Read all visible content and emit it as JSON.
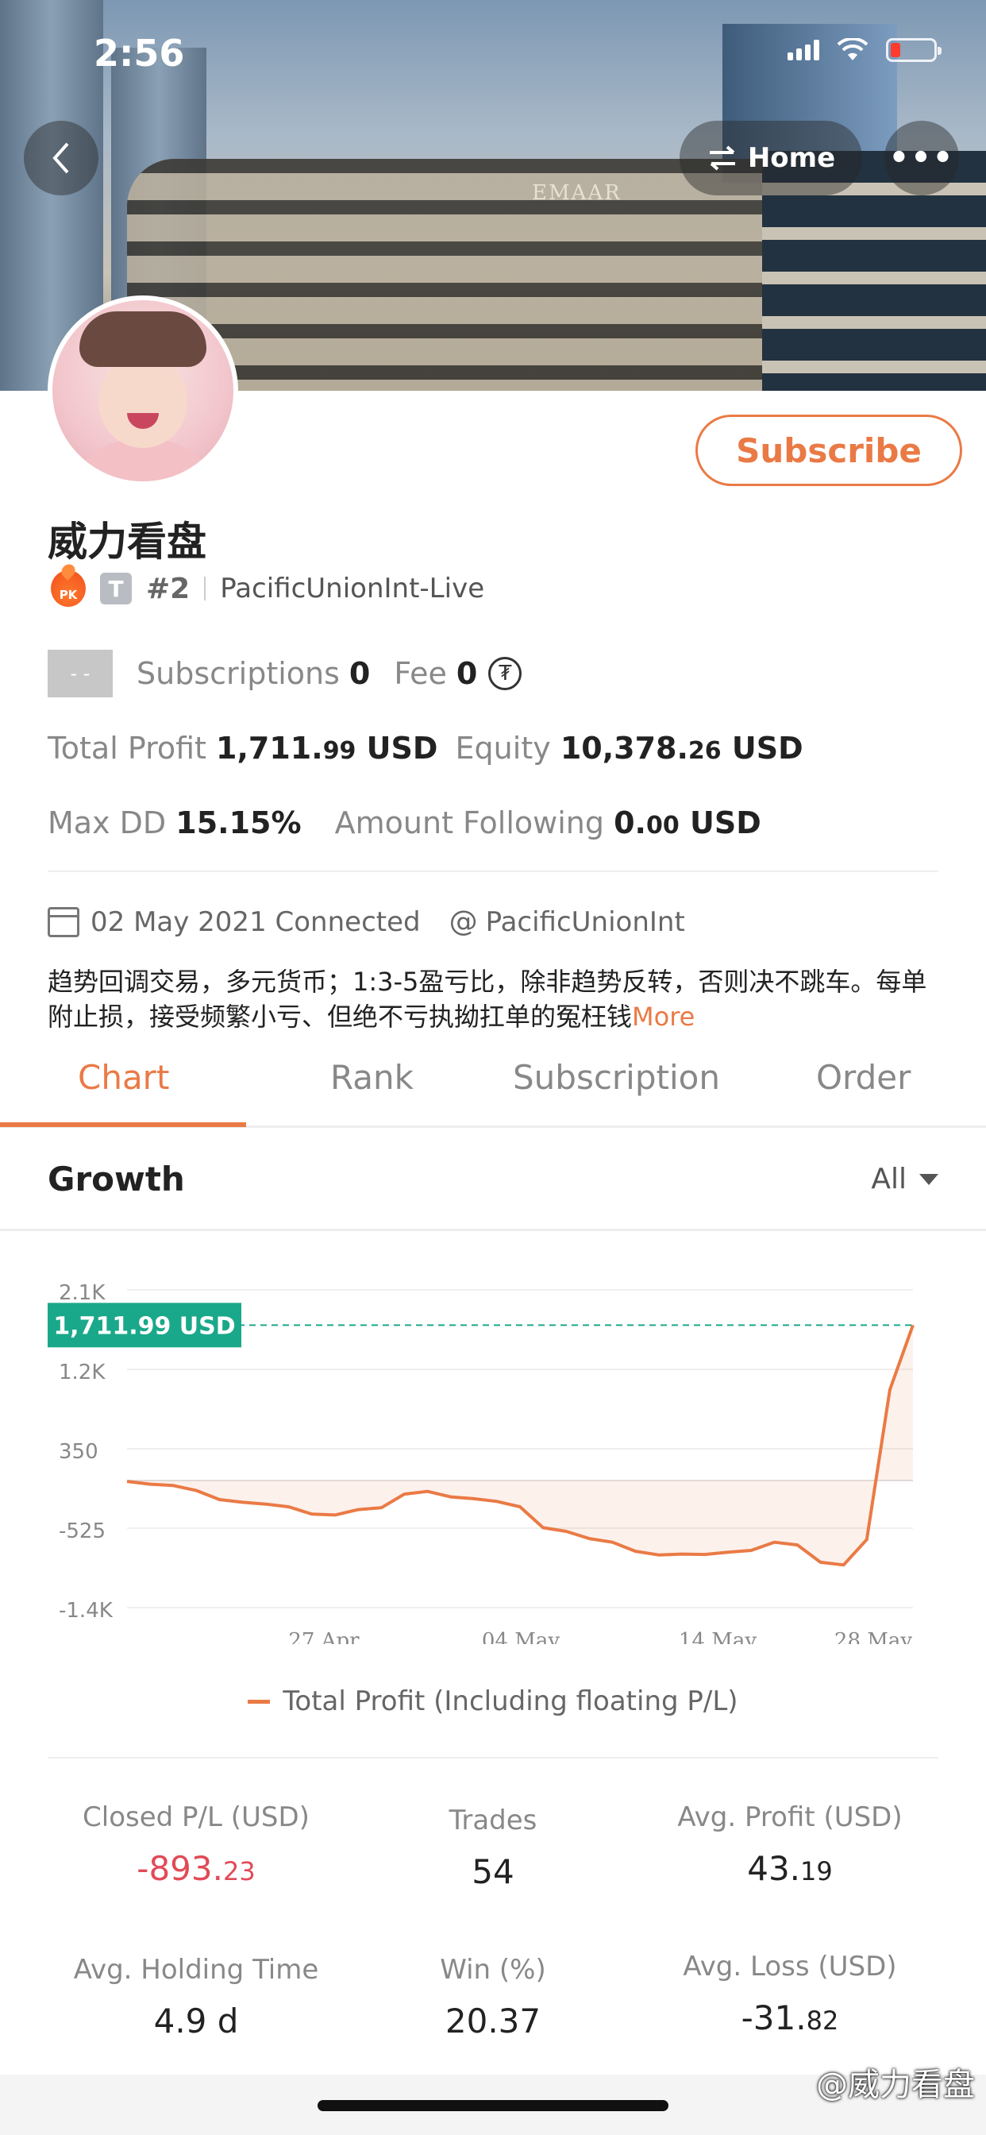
{
  "status_bar": {
    "time": "2:56"
  },
  "nav": {
    "home_label": "Home"
  },
  "profile": {
    "name": "威力看盘",
    "pk_badge": "PK",
    "type_badge": "T",
    "rank": "#2",
    "broker": "PacificUnionInt-Live",
    "placeholder_box": "- -",
    "subscribe_label": "Subscribe"
  },
  "summary": {
    "subscriptions_label": "Subscriptions",
    "subscriptions_value": "0",
    "fee_label": "Fee",
    "fee_value": "0",
    "fee_icon": "coin-icon",
    "total_profit_label": "Total Profit",
    "total_profit_main": "1,711.",
    "total_profit_dec": "99",
    "total_profit_unit": "USD",
    "equity_label": "Equity",
    "equity_main": "10,378.",
    "equity_dec": "26",
    "equity_unit": "USD",
    "max_dd_label": "Max DD",
    "max_dd_value": "15.15%",
    "amount_following_label": "Amount Following",
    "amount_following_main": "0.",
    "amount_following_dec": "00",
    "amount_following_unit": "USD"
  },
  "info": {
    "connected": "02 May 2021 Connected",
    "broker_handle": "PacificUnionInt",
    "description": "趋势回调交易，多元货币；1:3-5盈亏比，除非趋势反转，否则决不跳车。每单附止损，接受频繁小亏、但绝不亏执拗扛单的冤枉钱",
    "more_label": "More"
  },
  "tabs": [
    "Chart",
    "Rank",
    "Subscription",
    "Order"
  ],
  "growth": {
    "title": "Growth",
    "filter": "All"
  },
  "chart_data": {
    "type": "area",
    "yticks": [
      "2.1K",
      "1.2K",
      "350",
      "-525",
      "-1.4K"
    ],
    "ylim": [
      -1400,
      2100
    ],
    "xticks": [
      "27 Apr",
      "04 May",
      "14 May",
      "28 May"
    ],
    "current_label": "1,711.99 USD",
    "current_value": 1711.99,
    "series": [
      {
        "name": "Total Profit (Including floating P/L)",
        "color": "#ea7a45",
        "values": [
          -10,
          -40,
          -55,
          -110,
          -210,
          -240,
          -260,
          -290,
          -370,
          -380,
          -320,
          -300,
          -150,
          -120,
          -180,
          -200,
          -230,
          -290,
          -520,
          -560,
          -640,
          -680,
          -780,
          -820,
          -810,
          -815,
          -790,
          -770,
          -680,
          -710,
          -900,
          -930,
          -650,
          1000,
          1711.99
        ]
      }
    ]
  },
  "stats": {
    "closed_pl_label": "Closed P/L (USD)",
    "closed_pl_main": "-893.",
    "closed_pl_dec": "23",
    "trades_label": "Trades",
    "trades_value": "54",
    "avg_profit_label": "Avg. Profit (USD)",
    "avg_profit_main": "43.",
    "avg_profit_dec": "19",
    "avg_holding_label": "Avg. Holding Time",
    "avg_holding_value": "4.9 d",
    "win_label": "Win (%)",
    "win_value": "20.37",
    "avg_loss_label": "Avg. Loss (USD)",
    "avg_loss_main": "-31.",
    "avg_loss_dec": "82"
  },
  "watermark": "@威力看盘",
  "colors": {
    "accent": "#ea7a45",
    "green_label": "#1aa88a",
    "negative": "#e14a57"
  }
}
